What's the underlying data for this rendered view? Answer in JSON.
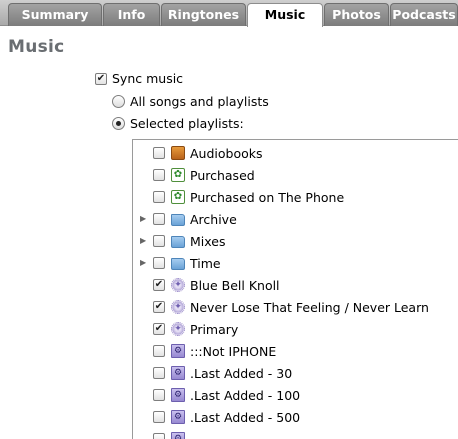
{
  "tabs": [
    {
      "label": "Summary",
      "active": false
    },
    {
      "label": "Info",
      "active": false
    },
    {
      "label": "Ringtones",
      "active": false
    },
    {
      "label": "Music",
      "active": true
    },
    {
      "label": "Photos",
      "active": false
    },
    {
      "label": "Podcasts",
      "active": false
    }
  ],
  "section": {
    "title": "Music"
  },
  "sync": {
    "label": "Sync music",
    "checked": true
  },
  "mode": {
    "all_label": "All songs and playlists",
    "selected_label": "Selected playlists:",
    "selected": "selected"
  },
  "playlists": [
    {
      "name": "Audiobooks",
      "icon": "audiobook-icon",
      "checked": false,
      "expandable": false
    },
    {
      "name": "Purchased",
      "icon": "purchased-icon",
      "checked": false,
      "expandable": false
    },
    {
      "name": "Purchased on The Phone",
      "icon": "purchased-icon",
      "checked": false,
      "expandable": false
    },
    {
      "name": "Archive",
      "icon": "folder-icon",
      "checked": false,
      "expandable": true
    },
    {
      "name": "Mixes",
      "icon": "folder-icon",
      "checked": false,
      "expandable": true
    },
    {
      "name": "Time",
      "icon": "folder-icon",
      "checked": false,
      "expandable": true
    },
    {
      "name": "Blue Bell Knoll",
      "icon": "genius-icon",
      "checked": true,
      "expandable": false
    },
    {
      "name": "Never Lose That Feeling / Never Learn",
      "icon": "genius-icon",
      "checked": true,
      "expandable": false
    },
    {
      "name": "Primary",
      "icon": "genius-icon",
      "checked": true,
      "expandable": false
    },
    {
      "name": ":::Not IPHONE",
      "icon": "smart-playlist-icon",
      "checked": false,
      "expandable": false
    },
    {
      "name": ".Last Added - 30",
      "icon": "smart-playlist-icon",
      "checked": false,
      "expandable": false
    },
    {
      "name": ".Last Added - 100",
      "icon": "smart-playlist-icon",
      "checked": false,
      "expandable": false
    },
    {
      "name": ".Last Added - 500",
      "icon": "smart-playlist-icon",
      "checked": false,
      "expandable": false
    },
    {
      "name": "",
      "icon": "smart-playlist-icon",
      "checked": false,
      "expandable": false
    }
  ]
}
